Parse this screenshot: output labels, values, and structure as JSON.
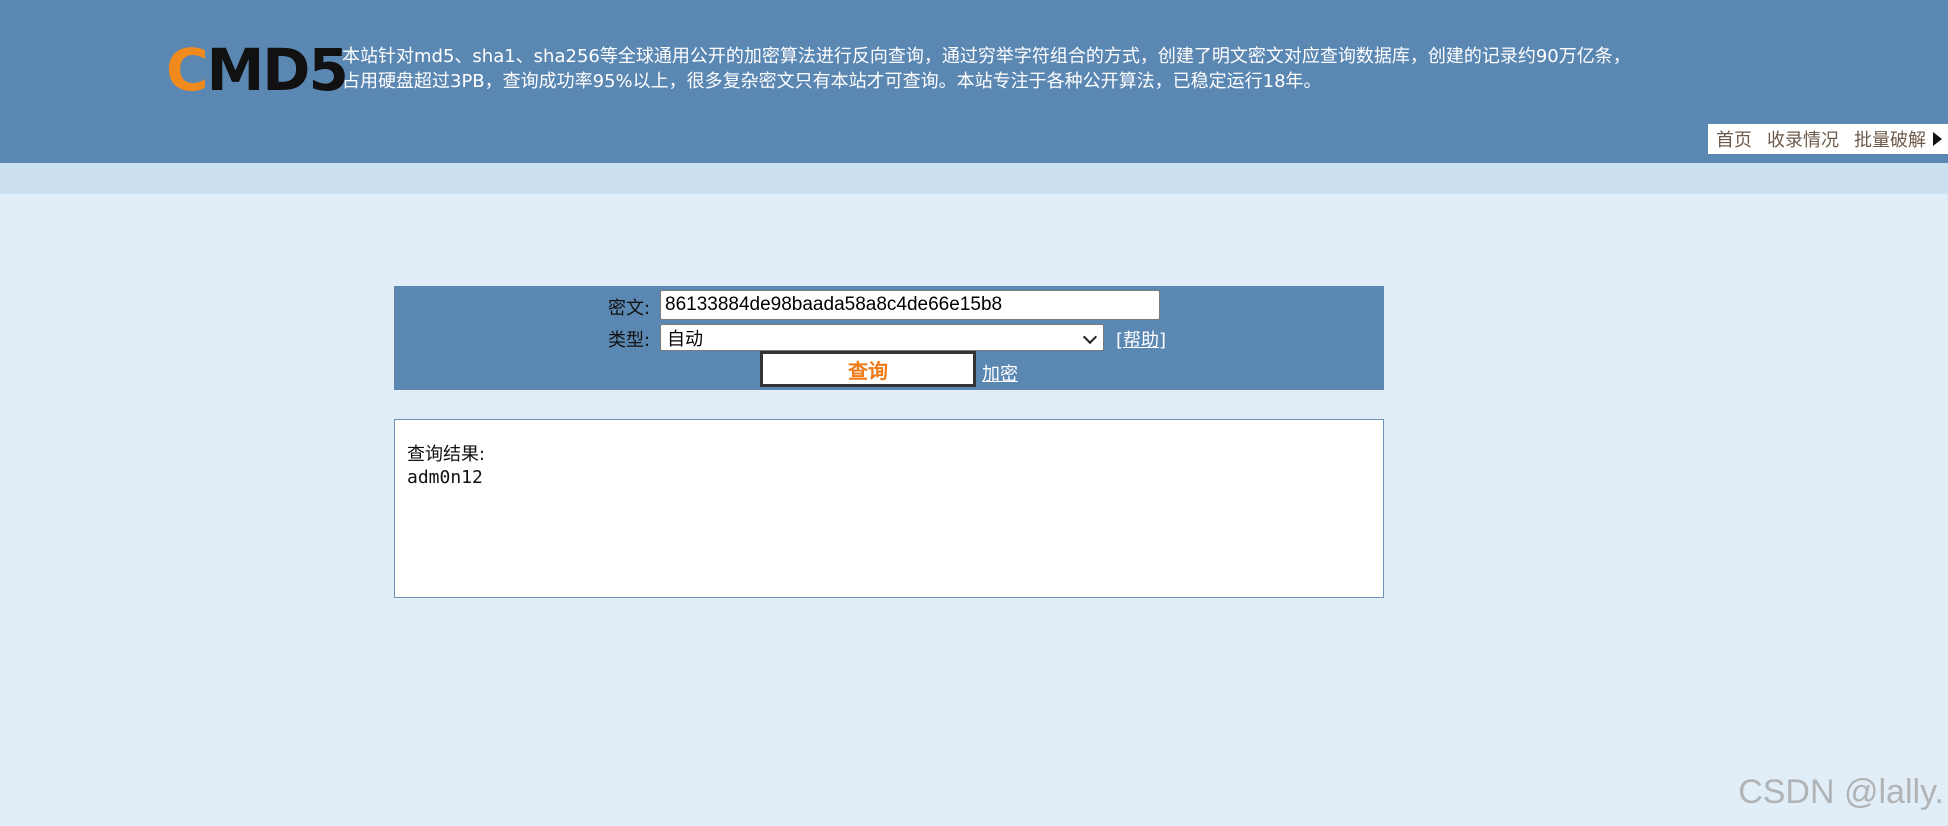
{
  "header": {
    "logo": {
      "first": "C",
      "rest": "MD5"
    },
    "intro_line1": "本站针对md5、sha1、sha256等全球通用公开的加密算法进行反向查询，通过穷举字符组合的方式，创建了明文密文对应查询数据库，创建的记录约90万亿条，",
    "intro_line2": "占用硬盘超过3PB，查询成功率95%以上，很多复杂密文只有本站才可查询。本站专注于各种公开算法，已稳定运行18年。"
  },
  "nav": {
    "items": [
      {
        "label": "首页"
      },
      {
        "label": "收录情况"
      },
      {
        "label": "批量破解"
      }
    ],
    "arrow_icon": "triangle-right-icon"
  },
  "form": {
    "cipher_label": "密文:",
    "cipher_value": "86133884de98baada58a8c4de66e15b8",
    "type_label": "类型:",
    "type_selected": "自动",
    "help_open": "[",
    "help_text": "帮助",
    "help_close": "]",
    "query_button": "查询",
    "encrypt_link": "加密"
  },
  "result": {
    "label": "查询结果:",
    "value": "adm0n12"
  },
  "watermark": "CSDN @lally.",
  "colors": {
    "header_bg": "#5b87b3",
    "page_bg": "#e1eef7",
    "subbar_bg": "#cbe0f1",
    "logo_accent": "#f08a1c",
    "button_text": "#f07a14"
  }
}
